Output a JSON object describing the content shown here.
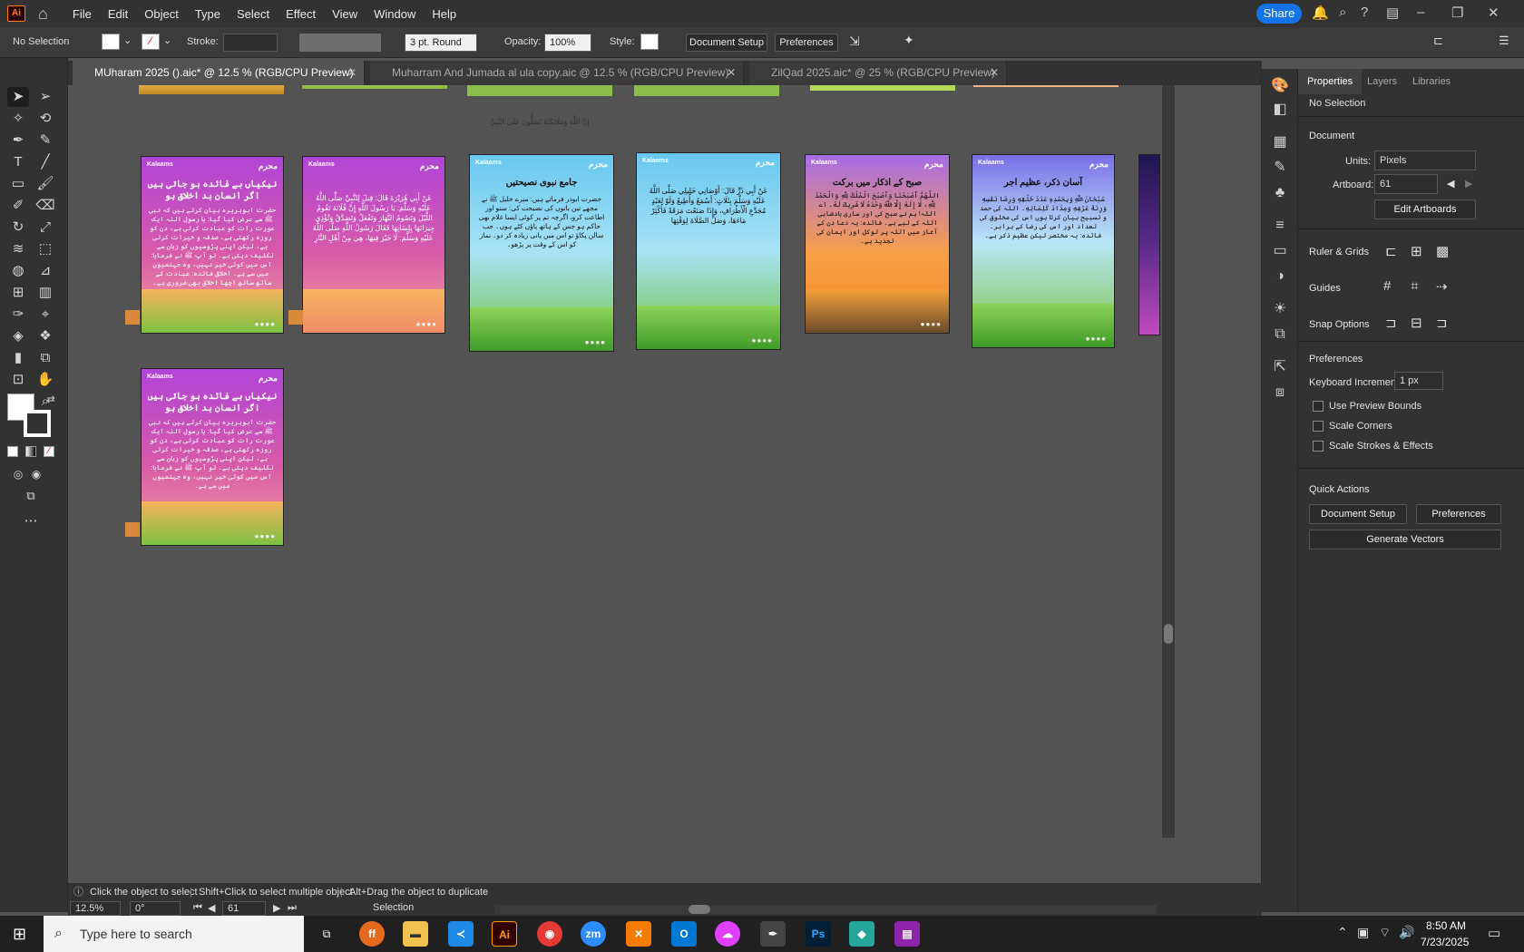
{
  "menubar": {
    "logo": "Ai",
    "items": [
      "File",
      "Edit",
      "Object",
      "Type",
      "Select",
      "Effect",
      "View",
      "Window",
      "Help"
    ],
    "share": "Share"
  },
  "control": {
    "selection": "No Selection",
    "stroke_label": "Stroke:",
    "brush": "3 pt. Round",
    "opacity_label": "Opacity:",
    "opacity_value": "100%",
    "style_label": "Style:",
    "doc_setup": "Document Setup",
    "preferences": "Preferences"
  },
  "tabs": [
    {
      "label": "MUharam 2025 ().aic* @ 12.5 % (RGB/CPU Preview)"
    },
    {
      "label": "Muharram And Jumada al ula copy.aic @ 12.5 % (RGB/CPU Preview)"
    },
    {
      "label": "ZilQad 2025.aic* @ 25 % (RGB/CPU Preview)"
    }
  ],
  "artboards": [
    {
      "brand": "Kalaams",
      "title": "نیکیاں بے فائدہ ہو جاتی ہیں اگر انسان بد اخلاق ہو",
      "body": "حضرت ابوہریرہ بیان کرتے ہیں کہ نبی ﷺ سے عرض کیا گیا: یا رسول اللہ ایک عورت رات کو عبادت کرتی ہے، دن کو روزہ رکھتی ہے، صدقہ و خیرات کرتی ہے، لیکن اپنی پڑوسیوں کو زبان سے تکلیف دیتی ہے۔ تو آپ ﷺ نے فرمایا: اس میں کوئی خیر نہیں، وہ جہنمیوں میں سے ہے۔ اخلاقی فائدہ: عبادت کے ساتھ ساتھ اچھا اخلاق بھی ضروری ہے۔"
    },
    {
      "brand": "Kalaams",
      "title": "",
      "body": "عَنْ أَبِي هُرَيْرَةَ قَالَ: قِيلَ لِلنَّبِيِّ صَلَّى اللَّهُ عَلَيْهِ وَسَلَّمَ: يَا رَسُولَ اللَّهِ إِنَّ فُلَانَةَ تَقُومُ اللَّيْلَ وَتَصُومُ النَّهَارَ وَتَفْعَلُ وَتَصَدَّقُ وَتُؤْذِي جِيرَانَهَا بِلِسَانِهَا فَقَالَ رَسُولُ اللَّهِ صَلَّى اللَّهُ عَلَيْهِ وَسَلَّمَ: لَا خَيْرَ فِيهَا، هِيَ مِنْ أَهْلِ النَّارِ"
    },
    {
      "brand": "Kalaams",
      "title": "جامع نبوی نصیحتیں",
      "body": "حضرت ابوذر فرماتے ہیں: میرے خلیل ﷺ نے مجھے تین باتوں کی نصیحت کی: سنو اور اطاعت کرو، اگرچہ تم پر کوئی ایسا غلام بھی حاکم ہو جس کے ہاتھ پاؤں کٹے ہوں۔ جب سالن پکاؤ تو اس میں پانی زیادہ کر دو۔ نماز کو اس کے وقت پر پڑھو۔"
    },
    {
      "brand": "Kalaams",
      "title": "",
      "body": "عَنْ أَبِي ذَرٍّ قَالَ: أَوْصَانِي خَلِيلِي صَلَّى اللَّهُ عَلَيْهِ وَسَلَّمَ بِثَلَاثٍ: أَسْمَعُ وَأُطِيعُ وَلَوْ لِعَبْدٍ مُجَدَّعِ الْأَطْرَافِ، وَإِذَا صَنَعْتَ مَرَقَةً فَأَكْثِرْ مَاءَهَا، وَصَلِّ الصَّلَاةَ لِوَقْتِهَا"
    },
    {
      "brand": "Kalaams",
      "title": "صبح کے اذکار میں برکت",
      "body": "اللَّهُمَّ أَصْبَحْنَا وَأَصْبَحَ الْمُلْكُ لِلَّهِ وَالْحَمْدُ لِلَّهِ، لَا إِلَهَ إِلَّا اللَّهُ وَحْدَهُ لَا شَرِيكَ لَهُ۔ اے اللہ! ہم نے صبح کی اور ساری بادشاہی اللہ کے لیے ہے۔ فائدہ: یہ دعا دن کے آغاز میں اللہ پر توکل اور ایمان کی تجدید ہے۔"
    },
    {
      "brand": "Kalaams",
      "title": "آسان ذکر، عظیم اجر",
      "body": "سُبْحَانَ اللَّهِ وَبِحَمْدِهِ عَدَدَ خَلْقِهِ وَرِضَا نَفْسِهِ وَزِنَةَ عَرْشِهِ وَمِدَادَ كَلِمَاتِهِ۔ اللہ کی حمد و تسبیح بیان کرتا ہوں اس کی مخلوق کی تعداد اور اس کی رضا کے برابر۔ فائدہ: یہ مختصر لیکن عظیم ذکر ہے۔"
    },
    {
      "brand": "Kalaams",
      "title": "نیکیاں بے فائدہ ہو جاتی ہیں اگر انسان بد اخلاق ہو",
      "body": "حضرت ابوہریرہ بیان کرتے ہیں کہ نبی ﷺ سے عرض کیا گیا: یا رسول اللہ ایک عورت رات کو عبادت کرتی ہے، دن کو روزہ رکھتی ہے، صدقہ و خیرات کرتی ہے، لیکن اپنی پڑوسیوں کو زبان سے تکلیف دیتی ہے۔ تو آپ ﷺ نے فرمایا: اس میں کوئی خیر نہیں، وہ جہنمیوں میں سے ہے۔"
    }
  ],
  "canvas_caption": "إِنَّ اللَّهَ وَمَلَائِكَتَهُ يُصَلُّونَ عَلَى النَّبِيِّ",
  "panel": {
    "tabs": [
      "Properties",
      "Layers",
      "Libraries"
    ],
    "no_selection": "No Selection",
    "document": "Document",
    "units_label": "Units:",
    "units_value": "Pixels",
    "artboard_label": "Artboard:",
    "artboard_value": "61",
    "edit_artboards": "Edit Artboards",
    "rulers_grids": "Ruler & Grids",
    "guides": "Guides",
    "snap_options": "Snap Options",
    "preferences": "Preferences",
    "keyboard_increment_label": "Keyboard Increment:",
    "keyboard_increment_value": "1 px",
    "use_preview_bounds": "Use Preview Bounds",
    "scale_corners": "Scale Corners",
    "scale_strokes": "Scale Strokes & Effects",
    "quick_actions": "Quick Actions",
    "doc_setup": "Document Setup",
    "prefs_btn": "Preferences",
    "generate_vectors": "Generate Vectors"
  },
  "status": {
    "hint_click": "Click the object to select",
    "hint_shift": "Shift+Click to select multiple object",
    "hint_alt": "Alt+Drag the object to duplicate",
    "zoom": "12.5%",
    "rotation": "0°",
    "artboard_nav": "61",
    "tool": "Selection"
  },
  "taskbar": {
    "search_placeholder": "Type here to search",
    "time": "8:50 AM",
    "date": "7/23/2025"
  }
}
